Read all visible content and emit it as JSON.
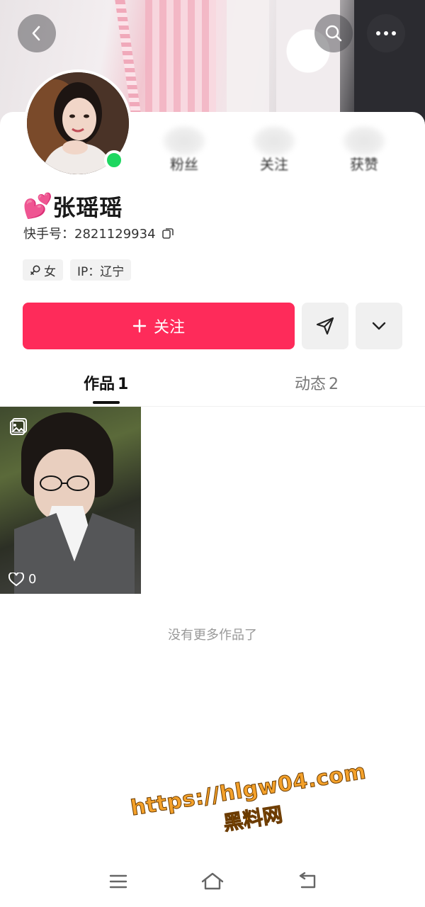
{
  "header": {
    "back_icon": "chevron-left-icon",
    "search_icon": "search-icon",
    "more_icon": "more-horizontal-icon"
  },
  "stats": [
    {
      "label": "粉丝"
    },
    {
      "label": "关注"
    },
    {
      "label": "获赞"
    }
  ],
  "profile": {
    "emoji": "💕",
    "name": "张瑶瑶",
    "uid_label": "快手号：",
    "uid": "2821129934",
    "online": true,
    "tags": {
      "gender": "女",
      "ip": "IP：辽宁"
    }
  },
  "actions": {
    "follow_label": "关注",
    "follow_color": "#fe2b5a"
  },
  "tabs": [
    {
      "label": "作品",
      "count": "1",
      "active": true
    },
    {
      "label": "动态",
      "count": "2",
      "active": false
    }
  ],
  "works": [
    {
      "likes": "0",
      "type": "gallery"
    }
  ],
  "footer": {
    "no_more_text": "没有更多作品了"
  },
  "watermark": {
    "url": "https://hlgw04.com",
    "name": "黑料网"
  }
}
